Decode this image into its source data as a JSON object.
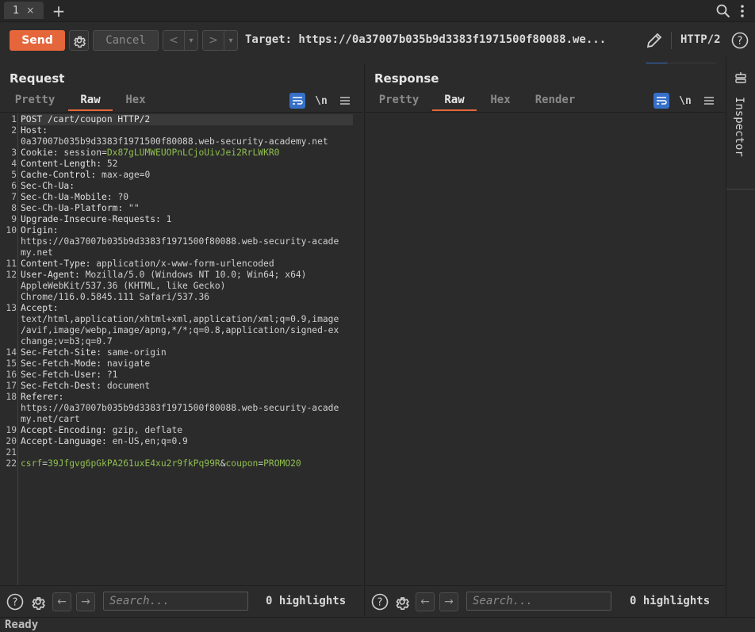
{
  "tabstrip": {
    "tab_label": "1",
    "close_glyph": "×",
    "add_glyph": "+"
  },
  "toolbar": {
    "send_label": "Send",
    "cancel_label": "Cancel",
    "target_text": "Target: https://0a37007b035b9d3383f1971500f80088.we...",
    "protocol": "HTTP/2"
  },
  "request": {
    "title": "Request",
    "tabs": [
      "Pretty",
      "Raw",
      "Hex"
    ],
    "active_tab": "Raw",
    "newline_label": "\\n",
    "lines": [
      {
        "n": "1",
        "parts": [
          {
            "t": "POST /cart/coupon HTTP/2",
            "c": "hname"
          }
        ],
        "hl": true
      },
      {
        "n": "2",
        "parts": [
          {
            "t": "Host:",
            "c": "hname"
          }
        ]
      },
      {
        "n": "",
        "parts": [
          {
            "t": "0a37007b035b9d3383f1971500f80088.web-security-academy.net",
            "c": "hval"
          }
        ]
      },
      {
        "n": "3",
        "parts": [
          {
            "t": "Cookie: ",
            "c": "hname"
          },
          {
            "t": "session",
            "c": "hval"
          },
          {
            "t": "=",
            "c": "hval"
          },
          {
            "t": "Dx87gLUMWEUOPnLCjoUivJei2RrLWKR0",
            "c": "green"
          }
        ]
      },
      {
        "n": "4",
        "parts": [
          {
            "t": "Content-Length: ",
            "c": "hname"
          },
          {
            "t": "52",
            "c": "hval"
          }
        ]
      },
      {
        "n": "5",
        "parts": [
          {
            "t": "Cache-Control: ",
            "c": "hname"
          },
          {
            "t": "max-age=0",
            "c": "hval"
          }
        ]
      },
      {
        "n": "6",
        "parts": [
          {
            "t": "Sec-Ch-Ua:",
            "c": "hname"
          }
        ]
      },
      {
        "n": "7",
        "parts": [
          {
            "t": "Sec-Ch-Ua-Mobile: ",
            "c": "hname"
          },
          {
            "t": "?0",
            "c": "hval"
          }
        ]
      },
      {
        "n": "8",
        "parts": [
          {
            "t": "Sec-Ch-Ua-Platform: ",
            "c": "hname"
          },
          {
            "t": "\"\"",
            "c": "hval"
          }
        ]
      },
      {
        "n": "9",
        "parts": [
          {
            "t": "Upgrade-Insecure-Requests: ",
            "c": "hname"
          },
          {
            "t": "1",
            "c": "hval"
          }
        ]
      },
      {
        "n": "10",
        "parts": [
          {
            "t": "Origin:",
            "c": "hname"
          }
        ]
      },
      {
        "n": "",
        "parts": [
          {
            "t": "https://0a37007b035b9d3383f1971500f80088.web-security-acade",
            "c": "hval"
          }
        ]
      },
      {
        "n": "",
        "parts": [
          {
            "t": "my.net",
            "c": "hval"
          }
        ]
      },
      {
        "n": "11",
        "parts": [
          {
            "t": "Content-Type: ",
            "c": "hname"
          },
          {
            "t": "application/x-www-form-urlencoded",
            "c": "hval"
          }
        ]
      },
      {
        "n": "12",
        "parts": [
          {
            "t": "User-Agent: ",
            "c": "hname"
          },
          {
            "t": "Mozilla/5.0 (Windows NT 10.0; Win64; x64)",
            "c": "hval"
          }
        ]
      },
      {
        "n": "",
        "parts": [
          {
            "t": "AppleWebKit/537.36 (KHTML, like Gecko)",
            "c": "hval"
          }
        ]
      },
      {
        "n": "",
        "parts": [
          {
            "t": "Chrome/116.0.5845.111 Safari/537.36",
            "c": "hval"
          }
        ]
      },
      {
        "n": "13",
        "parts": [
          {
            "t": "Accept:",
            "c": "hname"
          }
        ]
      },
      {
        "n": "",
        "parts": [
          {
            "t": "text/html,application/xhtml+xml,application/xml;q=0.9,image",
            "c": "hval"
          }
        ]
      },
      {
        "n": "",
        "parts": [
          {
            "t": "/avif,image/webp,image/apng,*/*;q=0.8,application/signed-ex",
            "c": "hval"
          }
        ]
      },
      {
        "n": "",
        "parts": [
          {
            "t": "change;v=b3;q=0.7",
            "c": "hval"
          }
        ]
      },
      {
        "n": "14",
        "parts": [
          {
            "t": "Sec-Fetch-Site: ",
            "c": "hname"
          },
          {
            "t": "same-origin",
            "c": "hval"
          }
        ]
      },
      {
        "n": "15",
        "parts": [
          {
            "t": "Sec-Fetch-Mode: ",
            "c": "hname"
          },
          {
            "t": "navigate",
            "c": "hval"
          }
        ]
      },
      {
        "n": "16",
        "parts": [
          {
            "t": "Sec-Fetch-User: ",
            "c": "hname"
          },
          {
            "t": "?1",
            "c": "hval"
          }
        ]
      },
      {
        "n": "17",
        "parts": [
          {
            "t": "Sec-Fetch-Dest: ",
            "c": "hname"
          },
          {
            "t": "document",
            "c": "hval"
          }
        ]
      },
      {
        "n": "18",
        "parts": [
          {
            "t": "Referer:",
            "c": "hname"
          }
        ]
      },
      {
        "n": "",
        "parts": [
          {
            "t": "https://0a37007b035b9d3383f1971500f80088.web-security-acade",
            "c": "hval"
          }
        ]
      },
      {
        "n": "",
        "parts": [
          {
            "t": "my.net/cart",
            "c": "hval"
          }
        ]
      },
      {
        "n": "19",
        "parts": [
          {
            "t": "Accept-Encoding: ",
            "c": "hname"
          },
          {
            "t": "gzip, deflate",
            "c": "hval"
          }
        ]
      },
      {
        "n": "20",
        "parts": [
          {
            "t": "Accept-Language: ",
            "c": "hname"
          },
          {
            "t": "en-US,en;q=0.9",
            "c": "hval"
          }
        ]
      },
      {
        "n": "21",
        "parts": []
      },
      {
        "n": "22",
        "parts": [
          {
            "t": "csrf",
            "c": "green"
          },
          {
            "t": "=",
            "c": "hval"
          },
          {
            "t": "39Jfgvg6pGkPA261uxE4xu2r9fkPq99R",
            "c": "green"
          },
          {
            "t": "&",
            "c": "hval"
          },
          {
            "t": "coupon",
            "c": "green"
          },
          {
            "t": "=",
            "c": "hval"
          },
          {
            "t": "PROMO20",
            "c": "green"
          }
        ]
      }
    ],
    "search_placeholder": "Search...",
    "highlights": "0 highlights"
  },
  "response": {
    "title": "Response",
    "tabs": [
      "Pretty",
      "Raw",
      "Hex",
      "Render"
    ],
    "active_tab": "Raw",
    "newline_label": "\\n",
    "search_placeholder": "Search...",
    "highlights": "0 highlights"
  },
  "inspector": {
    "label": "Inspector"
  },
  "status": {
    "text": "Ready"
  },
  "colors": {
    "accent": "#e4663a",
    "toggle_active": "#3670c8",
    "param_value": "#8fbf4e"
  }
}
